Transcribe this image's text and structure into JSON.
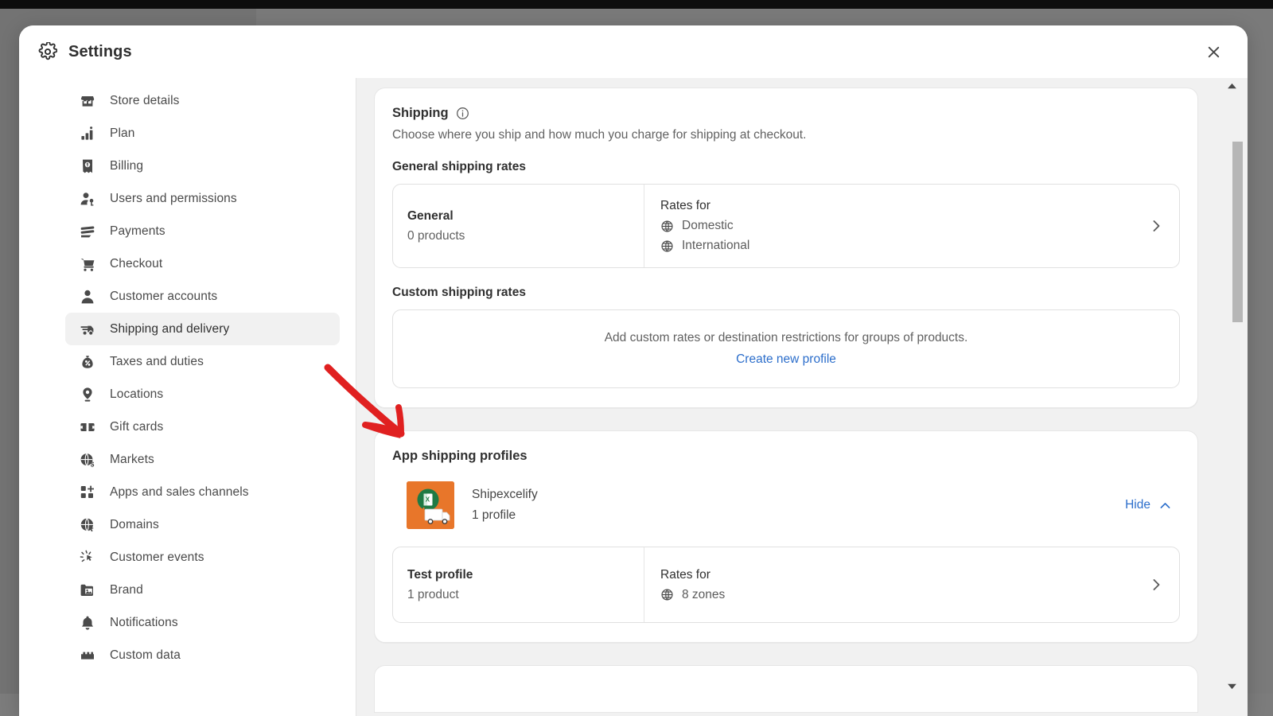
{
  "window": {
    "title": "Settings",
    "gear_icon": "gear-icon",
    "close_icon": "close-icon"
  },
  "sidebar": {
    "items": [
      {
        "label": "Store details",
        "icon": "store-icon",
        "active": false
      },
      {
        "label": "Plan",
        "icon": "plan-chart-icon",
        "active": false
      },
      {
        "label": "Billing",
        "icon": "billing-icon",
        "active": false
      },
      {
        "label": "Users and permissions",
        "icon": "users-icon",
        "active": false
      },
      {
        "label": "Payments",
        "icon": "payments-icon",
        "active": false
      },
      {
        "label": "Checkout",
        "icon": "cart-icon",
        "active": false
      },
      {
        "label": "Customer accounts",
        "icon": "person-icon",
        "active": false
      },
      {
        "label": "Shipping and delivery",
        "icon": "truck-icon",
        "active": true
      },
      {
        "label": "Taxes and duties",
        "icon": "tax-bag-icon",
        "active": false
      },
      {
        "label": "Locations",
        "icon": "location-pin-icon",
        "active": false
      },
      {
        "label": "Gift cards",
        "icon": "gift-card-icon",
        "active": false
      },
      {
        "label": "Markets",
        "icon": "globe-dollar-icon",
        "active": false
      },
      {
        "label": "Apps and sales channels",
        "icon": "apps-grid-icon",
        "active": false
      },
      {
        "label": "Domains",
        "icon": "domain-globe-icon",
        "active": false
      },
      {
        "label": "Customer events",
        "icon": "click-spark-icon",
        "active": false
      },
      {
        "label": "Brand",
        "icon": "brand-image-icon",
        "active": false
      },
      {
        "label": "Notifications",
        "icon": "bell-icon",
        "active": false
      },
      {
        "label": "Custom data",
        "icon": "custom-data-icon",
        "active": false
      }
    ]
  },
  "shipping_card": {
    "title": "Shipping",
    "info_icon": "info-icon",
    "subtitle": "Choose where you ship and how much you charge for shipping at checkout.",
    "general_section_label": "General shipping rates",
    "general_profile": {
      "name": "General",
      "products": "0 products",
      "rates_label": "Rates for",
      "zones": [
        "Domestic",
        "International"
      ],
      "chevron_icon": "chevron-right-icon",
      "globe_icon": "globe-icon"
    },
    "custom_section_label": "Custom shipping rates",
    "custom_empty": {
      "text": "Add custom rates or destination restrictions for groups of products.",
      "link": "Create new profile"
    }
  },
  "app_profiles_card": {
    "title": "App shipping profiles",
    "app": {
      "name": "Shipexcelify",
      "profile_count": "1 profile",
      "icon": "shipexcelify-app-icon",
      "toggle_label": "Hide",
      "toggle_icon": "chevron-up-icon"
    },
    "profiles": [
      {
        "name": "Test profile",
        "products": "1 product",
        "rates_label": "Rates for",
        "zones": [
          "8 zones"
        ],
        "chevron_icon": "chevron-right-icon",
        "globe_icon": "globe-icon"
      }
    ]
  },
  "scrollbar": {
    "up_icon": "scroll-up-arrow-icon",
    "down_icon": "scroll-down-arrow-icon"
  },
  "annotation": {
    "arrow": "red-annotation-arrow",
    "color": "#e02020"
  },
  "colors": {
    "accent_link": "#2c6ecb",
    "app_icon_orange": "#e8762a",
    "app_icon_green": "#1f7a44",
    "backdrop": "#7a7a7a",
    "card_bg": "#ffffff",
    "content_bg": "#f1f1f1"
  }
}
